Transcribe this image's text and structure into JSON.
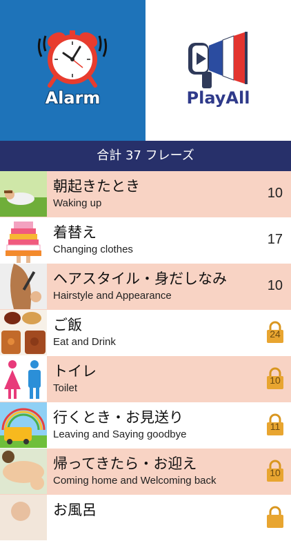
{
  "alarm_tile": {
    "label": "Alarm",
    "icon": "alarm-clock-icon"
  },
  "play_tile": {
    "label": "PlayAll",
    "icon": "megaphone-icon"
  },
  "header": {
    "title": "合計 37 フレーズ"
  },
  "categories": [
    {
      "jp": "朝起きたとき",
      "en": "Waking up",
      "count": "10",
      "locked": false,
      "thumb": "waking-up-thumbnail"
    },
    {
      "jp": "着替え",
      "en": "Changing clothes",
      "count": "17",
      "locked": false,
      "thumb": "changing-clothes-thumbnail"
    },
    {
      "jp": "ヘアスタイル・身だしなみ",
      "en": "Hairstyle and Appearance",
      "count": "10",
      "locked": false,
      "thumb": "hairstyle-thumbnail"
    },
    {
      "jp": "ご飯",
      "en": "Eat and Drink",
      "count": "24",
      "locked": true,
      "thumb": "food-thumbnail"
    },
    {
      "jp": "トイレ",
      "en": "Toilet",
      "count": "10",
      "locked": true,
      "thumb": "toilet-thumbnail"
    },
    {
      "jp": "行くとき・お見送り",
      "en": "Leaving and Saying goodbye",
      "count": "11",
      "locked": true,
      "thumb": "school-bus-thumbnail"
    },
    {
      "jp": "帰ってきたら・お迎え",
      "en": "Coming home and Welcoming back",
      "count": "10",
      "locked": true,
      "thumb": "welcoming-thumbnail"
    },
    {
      "jp": "お風呂",
      "en": "",
      "count": "",
      "locked": true,
      "thumb": "bath-thumbnail"
    }
  ],
  "colors": {
    "alarm_bg": "#1e73b9",
    "header_bg": "#27306a",
    "row_alt_bg": "#f8d3c4",
    "lock_gold": "#e0a030"
  }
}
